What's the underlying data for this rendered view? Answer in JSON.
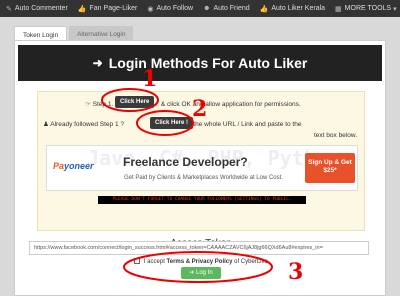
{
  "nav": {
    "items": [
      {
        "label": "Auto Commenter",
        "icon": "comment-icon"
      },
      {
        "label": "Fan Page-Liker",
        "icon": "thumbs-up-icon"
      },
      {
        "label": "Auto Follow",
        "icon": "rss-icon"
      },
      {
        "label": "Auto Friend",
        "icon": "user-icon"
      },
      {
        "label": "Auto Liker Kerala",
        "icon": "thumbs-up-icon"
      },
      {
        "label": "MORE TOOLS",
        "icon": "grid-icon"
      }
    ]
  },
  "tabs": [
    {
      "label": "Token Login"
    },
    {
      "label": "Alternative Login"
    }
  ],
  "title": "Login Methods For Auto Liker",
  "steps": {
    "step1_prefix": "Step 1.",
    "step1_button": "Click Here",
    "step1_suffix": "& click OK and allow application for permissions.",
    "step2_prefix": "Already followed Step 1 ?",
    "step2_button": "Click Here !",
    "step2_suffix": "& copy the whole URL / Link and paste to the",
    "step2_tail": "text box below."
  },
  "ad": {
    "logo_p": "Pa",
    "logo_rest": "yoneer",
    "headline": "Freelance Developer?",
    "subtext": "Get Paid by Clients & Marketplaces Worldwide at Low Cost.",
    "cta": "Sign Up & Get $25*",
    "bg_text": "Java, C#, PHP, Python, Scripts"
  },
  "notice": "PLEASE DON'T FORGET TO CHANGE YOUR FOLLOWERS [SETTINGS] TO PUBLIC.",
  "access": {
    "label": "Access Token",
    "value": "https://www.facebook.com/connect/login_success.html#access_token=CAAAACZAVC6jAJ8jg66QXd6Au8#expires_in=",
    "accept_prefix": "I accept",
    "accept_terms": "Terms & Privacy Policy",
    "accept_suffix": "of CyberLike",
    "login_button": "Log In"
  },
  "annotations": [
    "1",
    "2",
    "3"
  ],
  "colors": {
    "nav_bg": "#333333",
    "annotation": "#e00000",
    "login": "#5cb85c"
  }
}
